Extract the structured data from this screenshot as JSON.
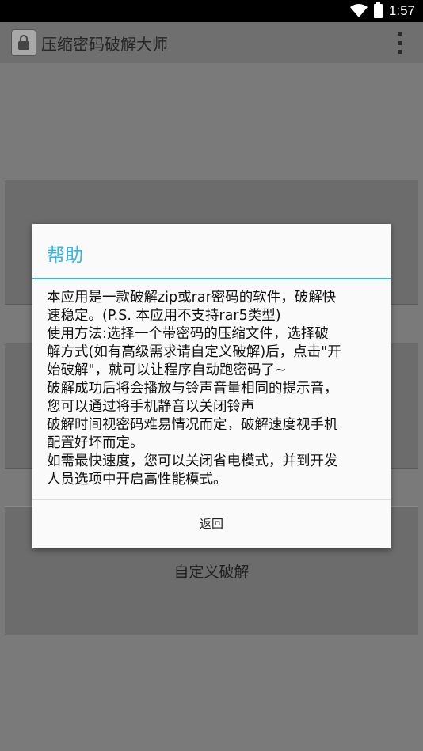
{
  "status_bar": {
    "time": "1:57"
  },
  "action_bar": {
    "title": "压缩密码破解大师"
  },
  "background": {
    "panel3_label": "自定义破解"
  },
  "dialog": {
    "title": "帮助",
    "lines": [
      "本应用是一款破解zip或rar密码的软件，破解快",
      "速稳定。(P.S. 本应用不支持rar5类型)",
      "使用方法:选择一个带密码的压缩文件，选择破",
      "解方式(如有高级需求请自定义破解)后，点击\"开",
      "始破解\"，就可以让程序自动跑密码了~",
      "破解成功后将会播放与铃声音量相同的提示音，",
      "您可以通过将手机静音以关闭铃声",
      "破解时间视密码难易情况而定，破解速度视手机",
      "配置好坏而定。",
      "如需最快速度，您可以关闭省电模式，并到开发",
      "人员选项中开启高性能模式。"
    ],
    "back_label": "返回"
  }
}
